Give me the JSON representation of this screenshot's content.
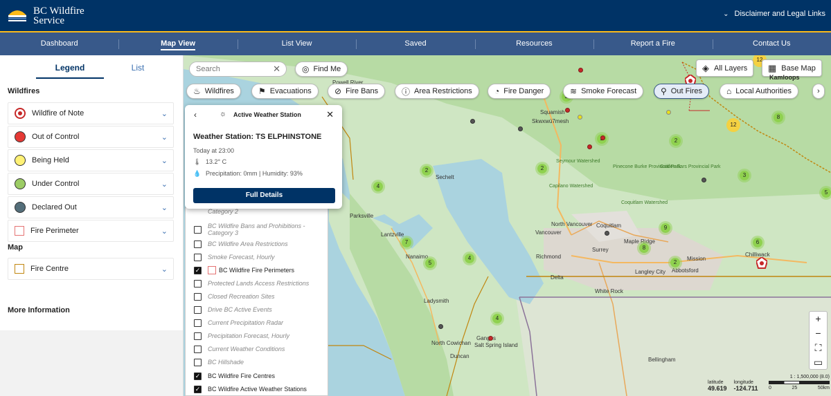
{
  "header": {
    "brand_line1": "BC Wildfire",
    "brand_line2": "Service",
    "disclaimer": "Disclaimer and Legal Links"
  },
  "nav": [
    "Dashboard",
    "Map View",
    "List View",
    "Saved",
    "Resources",
    "Report a Fire",
    "Contact Us"
  ],
  "sidebar": {
    "tabs": [
      "Legend",
      "List"
    ],
    "wildfires_heading": "Wildfires",
    "wildfire_items": [
      {
        "label": "Wildfire of Note",
        "color": "#c62828"
      },
      {
        "label": "Out of Control",
        "color": "#e53935"
      },
      {
        "label": "Being Held",
        "color": "#fff176"
      },
      {
        "label": "Under Control",
        "color": "#9ccc65"
      },
      {
        "label": "Declared Out",
        "color": "#546e7a"
      },
      {
        "label": "Fire Perimeter",
        "color": "#e57373"
      }
    ],
    "map_heading": "Map",
    "map_items": [
      {
        "label": "Fire Centre",
        "color": "#c1860f"
      }
    ],
    "more_info": "More Information"
  },
  "map": {
    "search_placeholder": "Search",
    "find_me": "Find Me",
    "all_layers": "All Layers",
    "base_map": "Base Map",
    "kamloops": "Kamloops",
    "filters": [
      "Wildfires",
      "Evacuations",
      "Fire Bans",
      "Area Restrictions",
      "Fire Danger",
      "Smoke Forecast",
      "Out Fires",
      "Local Authorities"
    ],
    "popup": {
      "header": "Active Weather Station",
      "station": "Weather Station: TS ELPHINSTONE",
      "time": "Today at 23:00",
      "temp": "13.2° C",
      "precip": "Precipitation: 0mm | Humidity: 93%",
      "button": "Full Details"
    },
    "layers": [
      {
        "label": "Category 2",
        "checked": false
      },
      {
        "label": "BC Wildfire Bans and Prohibitions - Category 3",
        "checked": false
      },
      {
        "label": "BC Wildfire Area Restrictions",
        "checked": false
      },
      {
        "label": "Smoke Forecast, Hourly",
        "checked": false
      },
      {
        "label": "BC Wildfire Fire Perimeters",
        "checked": true
      },
      {
        "label": "Protected Lands Access Restrictions",
        "checked": false
      },
      {
        "label": "Closed Recreation Sites",
        "checked": false
      },
      {
        "label": "Drive BC Active Events",
        "checked": false
      },
      {
        "label": "Current Precipitation Radar",
        "checked": false
      },
      {
        "label": "Precipitation Forecast, Hourly",
        "checked": false
      },
      {
        "label": "Current Weather Conditions",
        "checked": false
      },
      {
        "label": "BC Hillshade",
        "checked": false
      },
      {
        "label": "BC Wildfire Fire Centres",
        "checked": true
      },
      {
        "label": "BC Wildfire Active Weather Stations",
        "checked": true
      }
    ],
    "zoom_controls": [
      "+",
      "−",
      "⛶",
      "▭"
    ],
    "latitude_label": "latitude",
    "latitude": "49.619",
    "longitude_label": "longitude",
    "longitude": "-124.711",
    "scale_ratio": "1 : 1,500,000 (8.0)",
    "scale_ticks": [
      "0",
      "25",
      "50km"
    ],
    "place_labels": [
      "Powell River",
      "Squamish",
      "Skwxwú7mesh",
      "Sechelt",
      "Parksville",
      "Lantzville",
      "Nanaimo",
      "North Vancouver",
      "Vancouver",
      "Coquitlam",
      "Richmond",
      "Surrey",
      "Maple Ridge",
      "Delta",
      "Langley City",
      "Abbotsford",
      "White Rock",
      "Mission",
      "Chilliwack",
      "Ladysmith",
      "North Cowichan",
      "Duncan",
      "Ganges",
      "Salt Spring Island",
      "Bellingham",
      "Seymour Watershed",
      "Capilano Watershed",
      "Pinecone Burke Provincial Park",
      "Golden Ears Provincial Park",
      "Coquitlam Watershed"
    ],
    "clusters": [
      {
        "n": "12",
        "type": "y"
      },
      {
        "n": "2",
        "type": "g"
      },
      {
        "n": "12",
        "type": "y"
      },
      {
        "n": "8",
        "type": "g"
      },
      {
        "n": "2",
        "type": "g"
      },
      {
        "n": "2",
        "type": "g"
      },
      {
        "n": "2",
        "type": "g"
      },
      {
        "n": "3",
        "type": "g"
      },
      {
        "n": "4",
        "type": "g"
      },
      {
        "n": "2",
        "type": "g"
      },
      {
        "n": "5",
        "type": "g"
      },
      {
        "n": "9",
        "type": "g"
      },
      {
        "n": "7",
        "type": "g"
      },
      {
        "n": "6",
        "type": "g"
      },
      {
        "n": "8",
        "type": "g"
      },
      {
        "n": "5",
        "type": "g"
      },
      {
        "n": "4",
        "type": "g"
      },
      {
        "n": "2",
        "type": "g"
      },
      {
        "n": "4",
        "type": "g"
      }
    ]
  }
}
